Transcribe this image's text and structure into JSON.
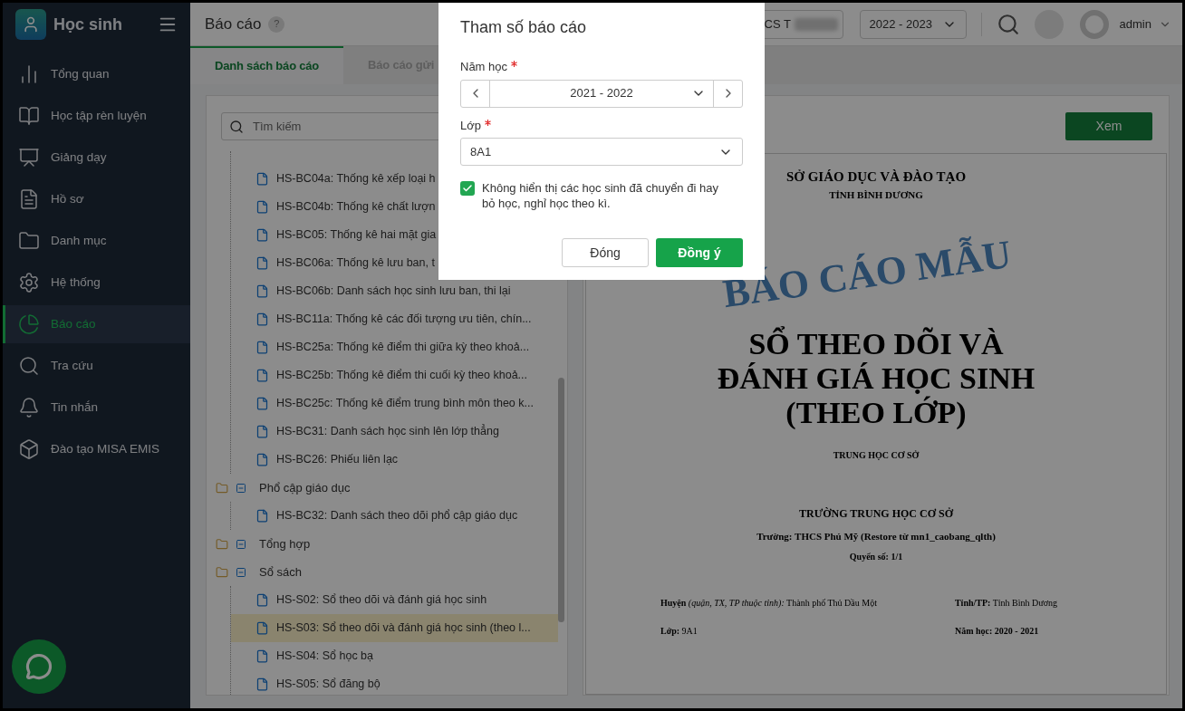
{
  "sidebar": {
    "app_name": "Học sinh",
    "items": [
      {
        "label": "Tổng quan",
        "selected": false
      },
      {
        "label": "Học tập rèn luyện",
        "selected": false
      },
      {
        "label": "Giảng dạy",
        "selected": false
      },
      {
        "label": "Hồ sơ",
        "selected": false
      },
      {
        "label": "Danh mục",
        "selected": false
      },
      {
        "label": "Hệ thống",
        "selected": false
      },
      {
        "label": "Báo cáo",
        "selected": true
      },
      {
        "label": "Tra cứu",
        "selected": false
      },
      {
        "label": "Tin nhắn",
        "selected": false
      },
      {
        "label": "Đào tạo MISA EMIS",
        "selected": false
      }
    ]
  },
  "header": {
    "title": "Báo cáo",
    "help": "?",
    "school": "CS T",
    "year": "2022 - 2023",
    "user": "admin"
  },
  "tabs": [
    {
      "label": "Danh sách báo cáo",
      "selected": true
    },
    {
      "label": "Báo cáo gửi",
      "selected": false
    }
  ],
  "search": {
    "placeholder": "Tìm kiếm"
  },
  "tree": {
    "continued_items": [
      {
        "label": "HS-BC04a: Thống kê xếp loại h",
        "selected": false
      },
      {
        "label": "HS-BC04b: Thống kê chất lượn",
        "selected": false
      },
      {
        "label": "HS-BC05: Thống kê hai mặt gia",
        "selected": false
      },
      {
        "label": "HS-BC06a: Thống kê lưu ban, t",
        "selected": false
      },
      {
        "label": "HS-BC06b: Danh sách học sinh lưu ban, thi lại",
        "selected": false
      },
      {
        "label": "HS-BC11a: Thống kê các đối tượng ưu tiên, chín...",
        "selected": false
      },
      {
        "label": "HS-BC25a: Thống kê điểm thi giữa kỳ theo khoả...",
        "selected": false
      },
      {
        "label": "HS-BC25b: Thống kê điểm thi cuối kỳ theo khoả...",
        "selected": false
      },
      {
        "label": "HS-BC25c: Thống kê điểm trung bình môn theo k...",
        "selected": false
      },
      {
        "label": "HS-BC31: Danh sách học sinh lên lớp thẳng",
        "selected": false
      },
      {
        "label": "HS-BC26: Phiếu liên lạc",
        "selected": false
      }
    ],
    "folders": [
      {
        "label": "Phổ cập giáo dục",
        "expanded": true,
        "children": [
          {
            "label": "HS-BC32: Danh sách theo dõi phổ cập giáo dục",
            "selected": false
          }
        ]
      },
      {
        "label": "Tổng hợp",
        "expanded": true
      },
      {
        "label": "Sổ sách",
        "expanded": true,
        "children": [
          {
            "label": "HS-S02: Sổ theo dõi và đánh giá học sinh",
            "selected": false
          },
          {
            "label": "HS-S03: Sổ theo dõi và đánh giá học sinh (theo l...",
            "selected": true
          },
          {
            "label": "HS-S04: Sổ học bạ",
            "selected": false
          },
          {
            "label": "HS-S05: Sổ đăng bộ",
            "selected": false
          }
        ]
      }
    ]
  },
  "preview": {
    "view_button": "Xem",
    "department": "SỞ GIÁO DỤC VÀ ĐÀO TẠO",
    "province": "TỈNH BÌNH DƯƠNG",
    "title_lines": [
      "SỔ THEO DÕI VÀ",
      "ĐÁNH GIÁ HỌC SINH",
      "(THEO LỚP)"
    ],
    "level": "TRUNG HỌC CƠ SỞ",
    "school_type": "TRƯỜNG TRUNG HỌC CƠ SỞ",
    "school": "Trường: THCS Phú Mỹ  (Restore từ mn1_caobang_qlth)",
    "volume": "Quyển số: 1/1",
    "stamp": "BÁO CÁO MẪU",
    "fields": [
      {
        "text": "**Huyện** *(quận, TX, TP thuộc tỉnh):* Thành phố Thủ Dầu Một",
        "bold": false
      },
      {
        "text": "**Tỉnh/TP:** Tỉnh Bình Dương",
        "bold": false
      },
      {
        "text": "**Lớp:** 9A1",
        "bold": false
      },
      {
        "text": "Năm học: 2020 - 2021",
        "bold": true
      }
    ]
  },
  "dialog": {
    "title": "Tham số báo cáo",
    "year_label": "Năm học",
    "year_required": true,
    "year": "2021 - 2022",
    "class_label": "Lớp",
    "class_required": true,
    "class": "8A1",
    "exclude_checkbox": {
      "label": "Không hiển thị các học sinh đã chuyển đi hay bỏ học, nghỉ học theo kì.",
      "checked": true
    },
    "buttons": [
      {
        "label": "Đóng",
        "kind": "secondary"
      },
      {
        "label": "Đồng ý",
        "kind": "primary"
      }
    ]
  }
}
